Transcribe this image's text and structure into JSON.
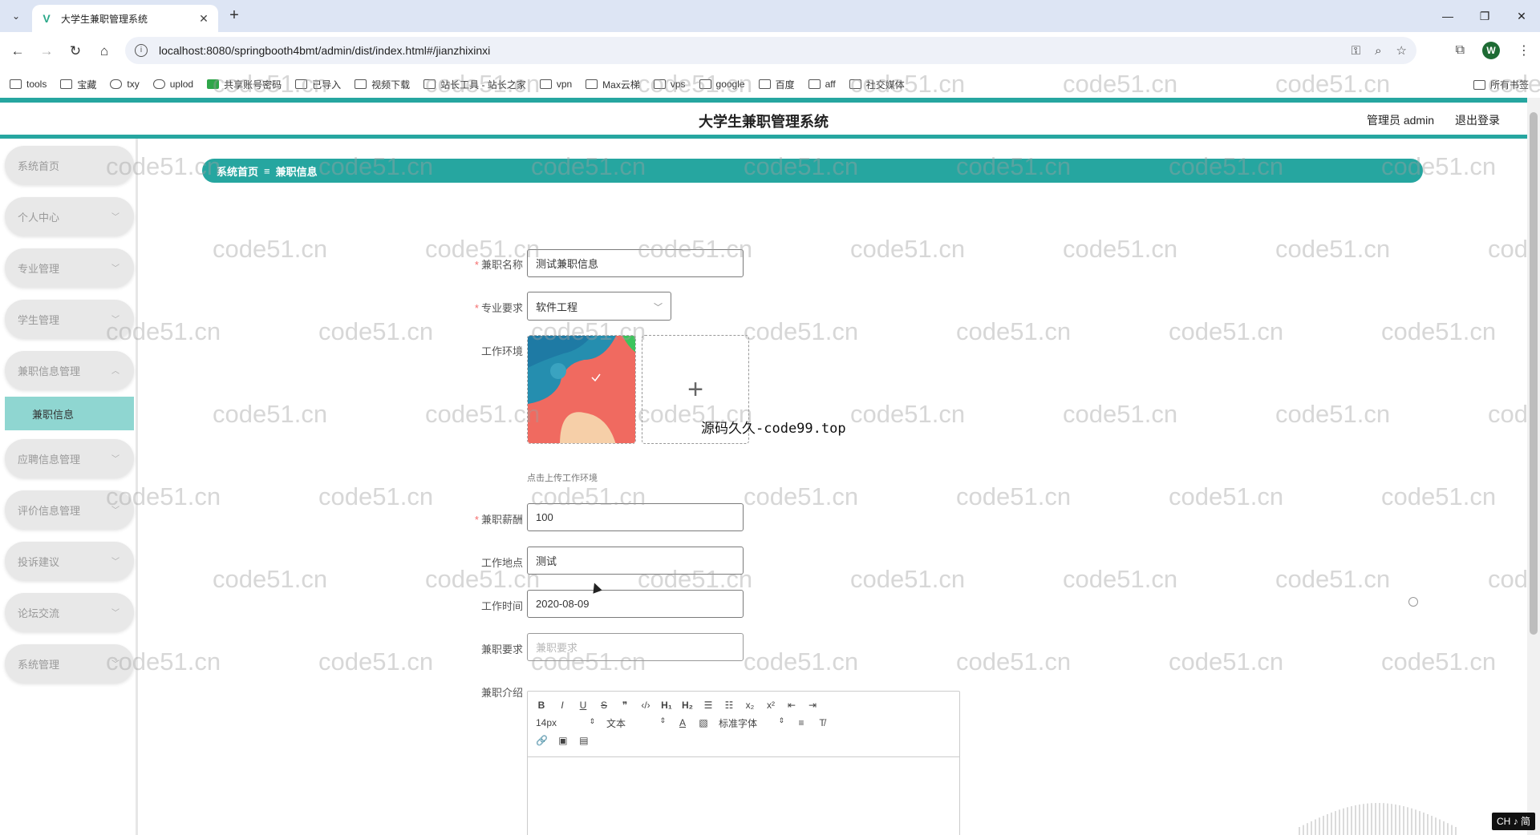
{
  "browser": {
    "tab_title": "大学生兼职管理系统",
    "url": "localhost:8080/springbooth4bmt/admin/dist/index.html#/jianzhixinxi",
    "profile_letter": "W",
    "bookmarks": [
      "tools",
      "宝藏",
      "txy",
      "uplod",
      "共享账号密码",
      "已导入",
      "视频下载",
      "站长工具 - 站长之家",
      "vpn",
      "Max云梯",
      "vps",
      "google",
      "百度",
      "aff",
      "社交媒体"
    ],
    "all_bookmarks": "所有书签"
  },
  "header": {
    "title": "大学生兼职管理系统",
    "user": "管理员 admin",
    "logout": "退出登录"
  },
  "sidebar": {
    "items": [
      "系统首页",
      "个人中心",
      "专业管理",
      "学生管理",
      "兼职信息管理",
      "应聘信息管理",
      "评价信息管理",
      "投诉建议",
      "论坛交流",
      "系统管理"
    ],
    "active_sub": "兼职信息"
  },
  "breadcrumb": {
    "home": "系统首页",
    "separator": "≡",
    "current": "兼职信息"
  },
  "form": {
    "name_label": "兼职名称",
    "name_value": "测试兼职信息",
    "major_label": "专业要求",
    "major_value": "软件工程",
    "env_label": "工作环境",
    "env_tip": "点击上传工作环境",
    "salary_label": "兼职薪酬",
    "salary_value": "100",
    "location_label": "工作地点",
    "location_value": "测试",
    "time_label": "工作时间",
    "time_value": "2020-08-09",
    "req_label": "兼职要求",
    "req_placeholder": "兼职要求",
    "intro_label": "兼职介绍"
  },
  "editor": {
    "font_size": "14px",
    "block_type": "文本",
    "font_family": "标准字体"
  },
  "overlay_text": "源码久久-code99.top",
  "watermark": "code51.cn",
  "ime": "CH ♪ 简"
}
